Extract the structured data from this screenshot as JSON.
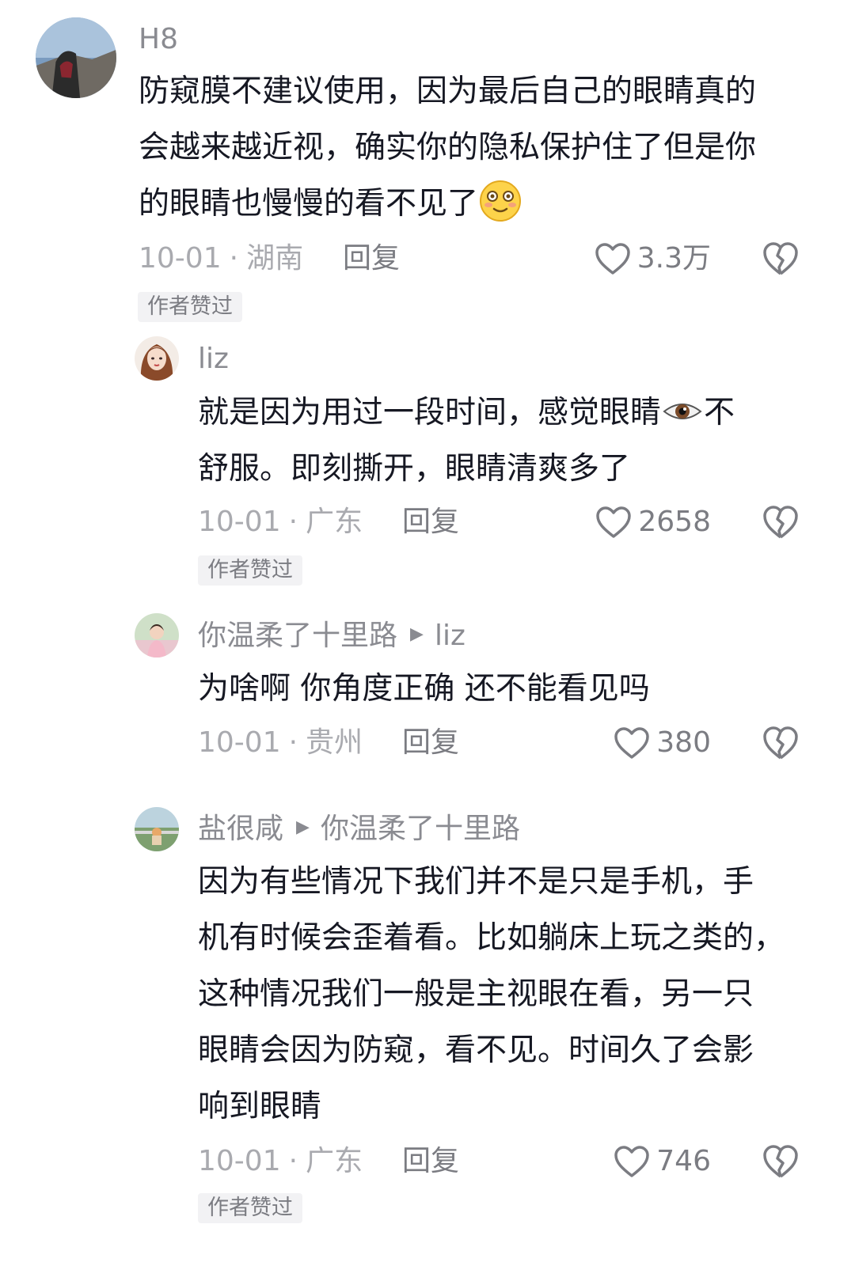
{
  "comments": [
    {
      "username": "H8",
      "text_parts": [
        "防窥膜不建议使用，因为最后自己的眼睛真的会越来越近视，确实你的隐私保护住了但是你的眼睛也慢慢的看不见了"
      ],
      "lines": [
        "防窥膜不建议使用，因为最后自己的眼睛真的",
        "会越来越近视，确实你的隐私保护住了但是你",
        "的眼睛也慢慢的看不见了"
      ],
      "emoji_icon": "blushing-smile-emoji-icon",
      "date": "10-01",
      "dot": "·",
      "location": "湖南",
      "reply_label": "回复",
      "likes": "3.3万",
      "author_badge": "作者赞过"
    },
    {
      "username": "liz",
      "lines": [
        "就是因为用过一段时间，感觉眼睛",
        "不",
        "舒服。即刻撕开，眼睛清爽多了"
      ],
      "emoji_icon": "eye-emoji-icon",
      "date": "10-01",
      "dot": "·",
      "location": "广东",
      "reply_label": "回复",
      "likes": "2658",
      "author_badge": "作者赞过"
    },
    {
      "username": "你温柔了十里路",
      "reply_to": "liz",
      "lines": [
        "为啥啊 你角度正确 还不能看见吗"
      ],
      "date": "10-01",
      "dot": "·",
      "location": "贵州",
      "reply_label": "回复",
      "likes": "380"
    },
    {
      "username": "盐很咸",
      "reply_to": "你温柔了十里路",
      "lines": [
        "因为有些情况下我们并不是只是手机，手",
        "机有时候会歪着看。比如躺床上玩之类的，",
        "这种情况我们一般是主视眼在看，另一只",
        "眼睛会因为防窥，看不见。时间久了会影",
        "响到眼睛"
      ],
      "date": "10-01",
      "dot": "·",
      "location": "广东",
      "reply_label": "回复",
      "likes": "746",
      "author_badge": "作者赞过"
    }
  ],
  "icons": {
    "like": "heart-outline-icon",
    "dislike": "broken-heart-icon",
    "reply_arrow": "play-triangle-icon"
  },
  "colors": {
    "text": "#161823",
    "secondary": "#8a8b91",
    "muted": "#a9aaaf",
    "badge_bg": "#f2f2f4"
  }
}
